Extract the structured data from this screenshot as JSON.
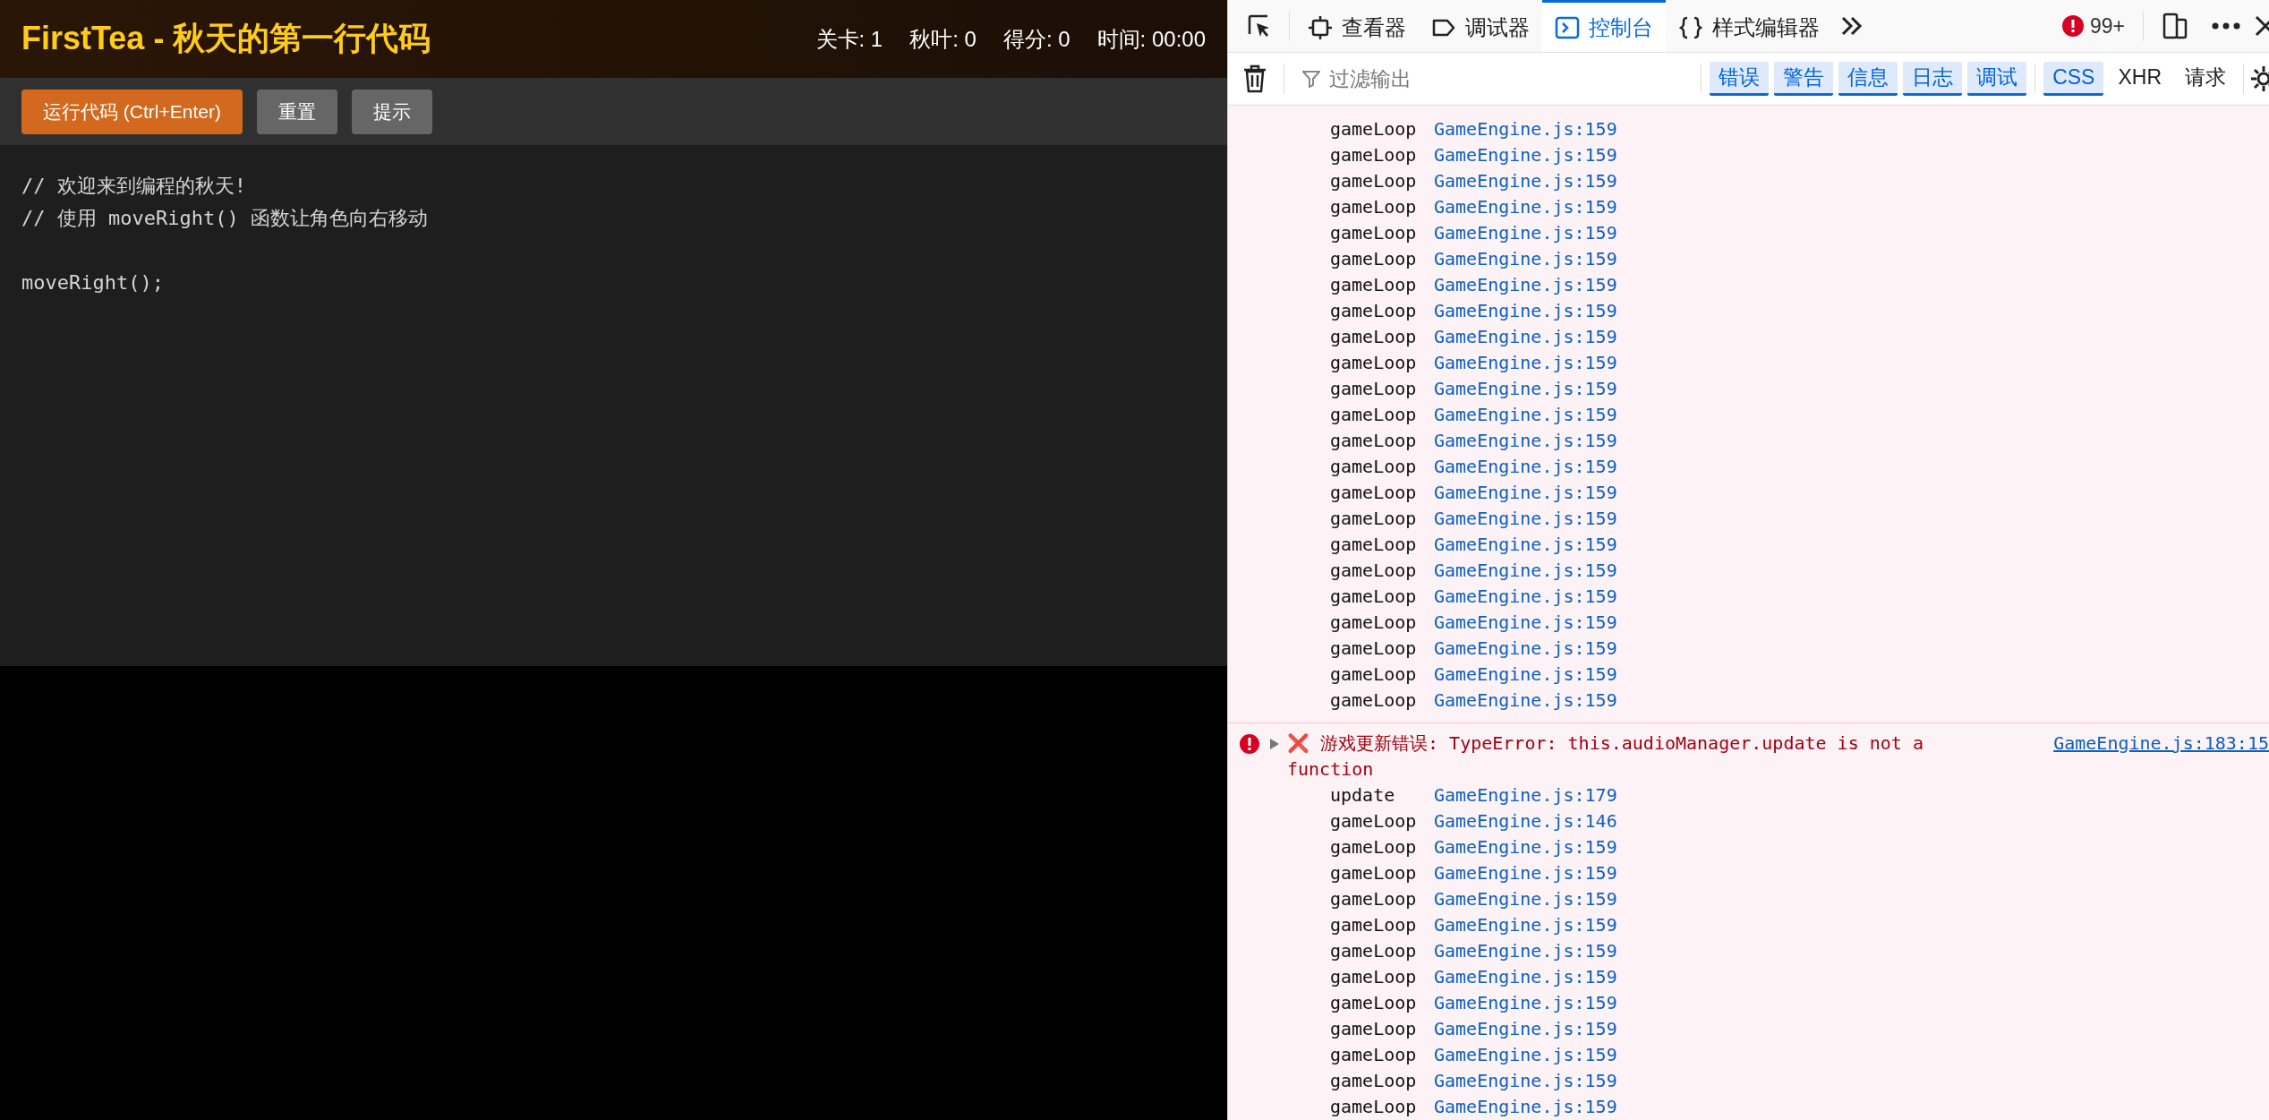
{
  "game": {
    "title": "FirstTea - 秋天的第一行代码",
    "stats": [
      "关卡: 1",
      "秋叶: 0",
      "得分: 0",
      "时间: 00:00"
    ],
    "buttons": [
      {
        "label": "运行代码 (Ctrl+Enter)",
        "kind": "primary"
      },
      {
        "label": "重置",
        "kind": "secondary"
      },
      {
        "label": "提示",
        "kind": "secondary"
      }
    ],
    "editor": {
      "blocks": [
        [
          "// 欢迎来到编程的秋天!",
          "// 使用 moveRight() 函数让角色向右移动"
        ],
        [
          "moveRight();"
        ]
      ]
    }
  },
  "devtools": {
    "tabs": [
      {
        "label": "查看器",
        "selected": false,
        "kind": "inspector"
      },
      {
        "label": "调试器",
        "selected": false,
        "kind": "debugger"
      },
      {
        "label": "控制台",
        "selected": true,
        "kind": "console"
      },
      {
        "label": "样式编辑器",
        "selected": false,
        "kind": "style"
      }
    ],
    "error_count": "99+",
    "filter": {
      "placeholder": "过滤输出"
    },
    "filters": [
      {
        "label": "错误",
        "selected": true
      },
      {
        "label": "警告",
        "selected": true
      },
      {
        "label": "信息",
        "selected": true
      },
      {
        "label": "日志",
        "selected": true
      },
      {
        "label": "调试",
        "selected": true
      },
      {
        "label": "CSS",
        "selected": true
      },
      {
        "label": "XHR",
        "selected": false
      },
      {
        "label": "请求",
        "selected": false
      }
    ],
    "console": [
      {
        "kind": "frame",
        "function": "gameLoop",
        "source": "GameEngine.js:159"
      },
      {
        "kind": "frame",
        "function": "gameLoop",
        "source": "GameEngine.js:159"
      },
      {
        "kind": "frame",
        "function": "gameLoop",
        "source": "GameEngine.js:159"
      },
      {
        "kind": "frame",
        "function": "gameLoop",
        "source": "GameEngine.js:159"
      },
      {
        "kind": "frame",
        "function": "gameLoop",
        "source": "GameEngine.js:159"
      },
      {
        "kind": "frame",
        "function": "gameLoop",
        "source": "GameEngine.js:159"
      },
      {
        "kind": "frame",
        "function": "gameLoop",
        "source": "GameEngine.js:159"
      },
      {
        "kind": "frame",
        "function": "gameLoop",
        "source": "GameEngine.js:159"
      },
      {
        "kind": "frame",
        "function": "gameLoop",
        "source": "GameEngine.js:159"
      },
      {
        "kind": "frame",
        "function": "gameLoop",
        "source": "GameEngine.js:159"
      },
      {
        "kind": "frame",
        "function": "gameLoop",
        "source": "GameEngine.js:159"
      },
      {
        "kind": "frame",
        "function": "gameLoop",
        "source": "GameEngine.js:159"
      },
      {
        "kind": "frame",
        "function": "gameLoop",
        "source": "GameEngine.js:159"
      },
      {
        "kind": "frame",
        "function": "gameLoop",
        "source": "GameEngine.js:159"
      },
      {
        "kind": "frame",
        "function": "gameLoop",
        "source": "GameEngine.js:159"
      },
      {
        "kind": "frame",
        "function": "gameLoop",
        "source": "GameEngine.js:159"
      },
      {
        "kind": "frame",
        "function": "gameLoop",
        "source": "GameEngine.js:159"
      },
      {
        "kind": "frame",
        "function": "gameLoop",
        "source": "GameEngine.js:159"
      },
      {
        "kind": "frame",
        "function": "gameLoop",
        "source": "GameEngine.js:159"
      },
      {
        "kind": "frame",
        "function": "gameLoop",
        "source": "GameEngine.js:159"
      },
      {
        "kind": "frame",
        "function": "gameLoop",
        "source": "GameEngine.js:159"
      },
      {
        "kind": "frame",
        "function": "gameLoop",
        "source": "GameEngine.js:159"
      },
      {
        "kind": "frame",
        "function": "gameLoop",
        "source": "GameEngine.js:159"
      },
      {
        "kind": "error",
        "message": "❌ 游戏更新错误: TypeError: this.audioManager.update is not a function",
        "source": "GameEngine.js:183:15"
      },
      {
        "kind": "frame",
        "function": "update",
        "source": "GameEngine.js:179"
      },
      {
        "kind": "frame",
        "function": "gameLoop",
        "source": "GameEngine.js:146"
      },
      {
        "kind": "frame",
        "function": "gameLoop",
        "source": "GameEngine.js:159"
      },
      {
        "kind": "frame",
        "function": "gameLoop",
        "source": "GameEngine.js:159"
      },
      {
        "kind": "frame",
        "function": "gameLoop",
        "source": "GameEngine.js:159"
      },
      {
        "kind": "frame",
        "function": "gameLoop",
        "source": "GameEngine.js:159"
      },
      {
        "kind": "frame",
        "function": "gameLoop",
        "source": "GameEngine.js:159"
      },
      {
        "kind": "frame",
        "function": "gameLoop",
        "source": "GameEngine.js:159"
      },
      {
        "kind": "frame",
        "function": "gameLoop",
        "source": "GameEngine.js:159"
      },
      {
        "kind": "frame",
        "function": "gameLoop",
        "source": "GameEngine.js:159"
      },
      {
        "kind": "frame",
        "function": "gameLoop",
        "source": "GameEngine.js:159"
      },
      {
        "kind": "frame",
        "function": "gameLoop",
        "source": "GameEngine.js:159"
      },
      {
        "kind": "frame",
        "function": "gameLoop",
        "source": "GameEngine.js:159"
      }
    ]
  }
}
